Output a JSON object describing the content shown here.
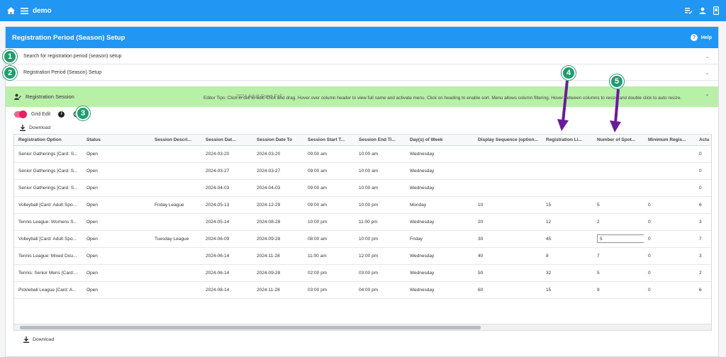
{
  "app": {
    "title": "demo"
  },
  "panel": {
    "title": "Registration Period (Season) Setup",
    "help_label": "Help",
    "help_glyph": "?"
  },
  "accordions": [
    {
      "label": "Search for registration period (season) setup"
    },
    {
      "label": "Registration Period (Season) Setup"
    }
  ],
  "session": {
    "title": "Registration Session",
    "subtitle": "2024 Adult Sport Fall"
  },
  "toolbar": {
    "grid_edit_label": "Grid Edit",
    "info_glyph": "i",
    "download_label": "Download"
  },
  "tips": "Editor Tips: Click in cell to edit. Click and drag. Hover over column header to view full name and activate menu. Click on heading to enable sort. Menu allows column filtering. Hover between columns to resize and double click to auto resize.",
  "grid": {
    "columns": [
      "Registration Option",
      "Status",
      "Session Descri...",
      "Session Dat...",
      "Session Date To",
      "Session Start T...",
      "Session End Ti...",
      "Day(s) of Week",
      "Display Sequence (option...",
      "Registration Li...",
      "Number of Spot...",
      "Minimum Regis...",
      "Actu"
    ],
    "rows": [
      [
        "Senior Gatherings [Card: S...",
        "Open",
        "",
        "2024-03-20",
        "2024-03-20",
        "09:00 am",
        "10:00 am",
        "Wednesday",
        "",
        "",
        "",
        "",
        "0"
      ],
      [
        "Senior Gatherings [Card: S...",
        "Open",
        "",
        "2024-03-27",
        "2024-03-27",
        "09:00 am",
        "10:00 am",
        "Wednesday",
        "",
        "",
        "",
        "",
        "0"
      ],
      [
        "Senior Gatherings [Card: S...",
        "Open",
        "",
        "2024-04-03",
        "2024-04-03",
        "09:00 am",
        "10:00 am",
        "Wednesday",
        "",
        "",
        "",
        "",
        "0"
      ],
      [
        "Volleyball [Card: Adult Spo...",
        "Open",
        "Friday League",
        "2024-05-13",
        "2024-12-29",
        "09:00 am",
        "10:00 pm",
        "Monday",
        "10",
        "15",
        "5",
        "0",
        "6"
      ],
      [
        "Tennis League: Womens S...",
        "Open",
        "",
        "2024-05-14",
        "2024-08-28",
        "10:00 pm",
        "11:00 pm",
        "Wednesday",
        "20",
        "12",
        "2",
        "0",
        "3"
      ],
      [
        "Volleyball [Card: Adult Spo...",
        "Open",
        "Tuesday League",
        "2024-06-09",
        "2024-09-28",
        "08:00 am",
        "10:00 pm",
        "Friday",
        "30",
        "45",
        "5",
        "0",
        "7"
      ],
      [
        "Tennis League: Mixed Dou...",
        "Open",
        "",
        "2024-06-14",
        "2024-11-28",
        "11:00 am",
        "12:00 pm",
        "Wednesday",
        "40",
        "8",
        "7",
        "0",
        "3"
      ],
      [
        "Tennis: Senior Mens [Card:...",
        "Open",
        "",
        "2024-06-14",
        "2024-09-28",
        "02:00 pm",
        "03:00 pm",
        "Wednesday",
        "50",
        "32",
        "5",
        "0",
        "2"
      ],
      [
        "Pickleball League [Card: A...",
        "Open",
        "",
        "2024-08-14",
        "2024-11-28",
        "03:00 pm",
        "04:00 pm",
        "Wednesday",
        "60",
        "15",
        "9",
        "0",
        "6"
      ]
    ],
    "editing_cell_value": "5"
  },
  "badges": [
    "1",
    "2",
    "3",
    "4",
    "5"
  ],
  "colors": {
    "primary": "#2196f3",
    "session_bar": "#b8f0a8",
    "badge": "#1f9d6e",
    "arrow": "#6a1b9a",
    "toggle": "#e91e63"
  }
}
